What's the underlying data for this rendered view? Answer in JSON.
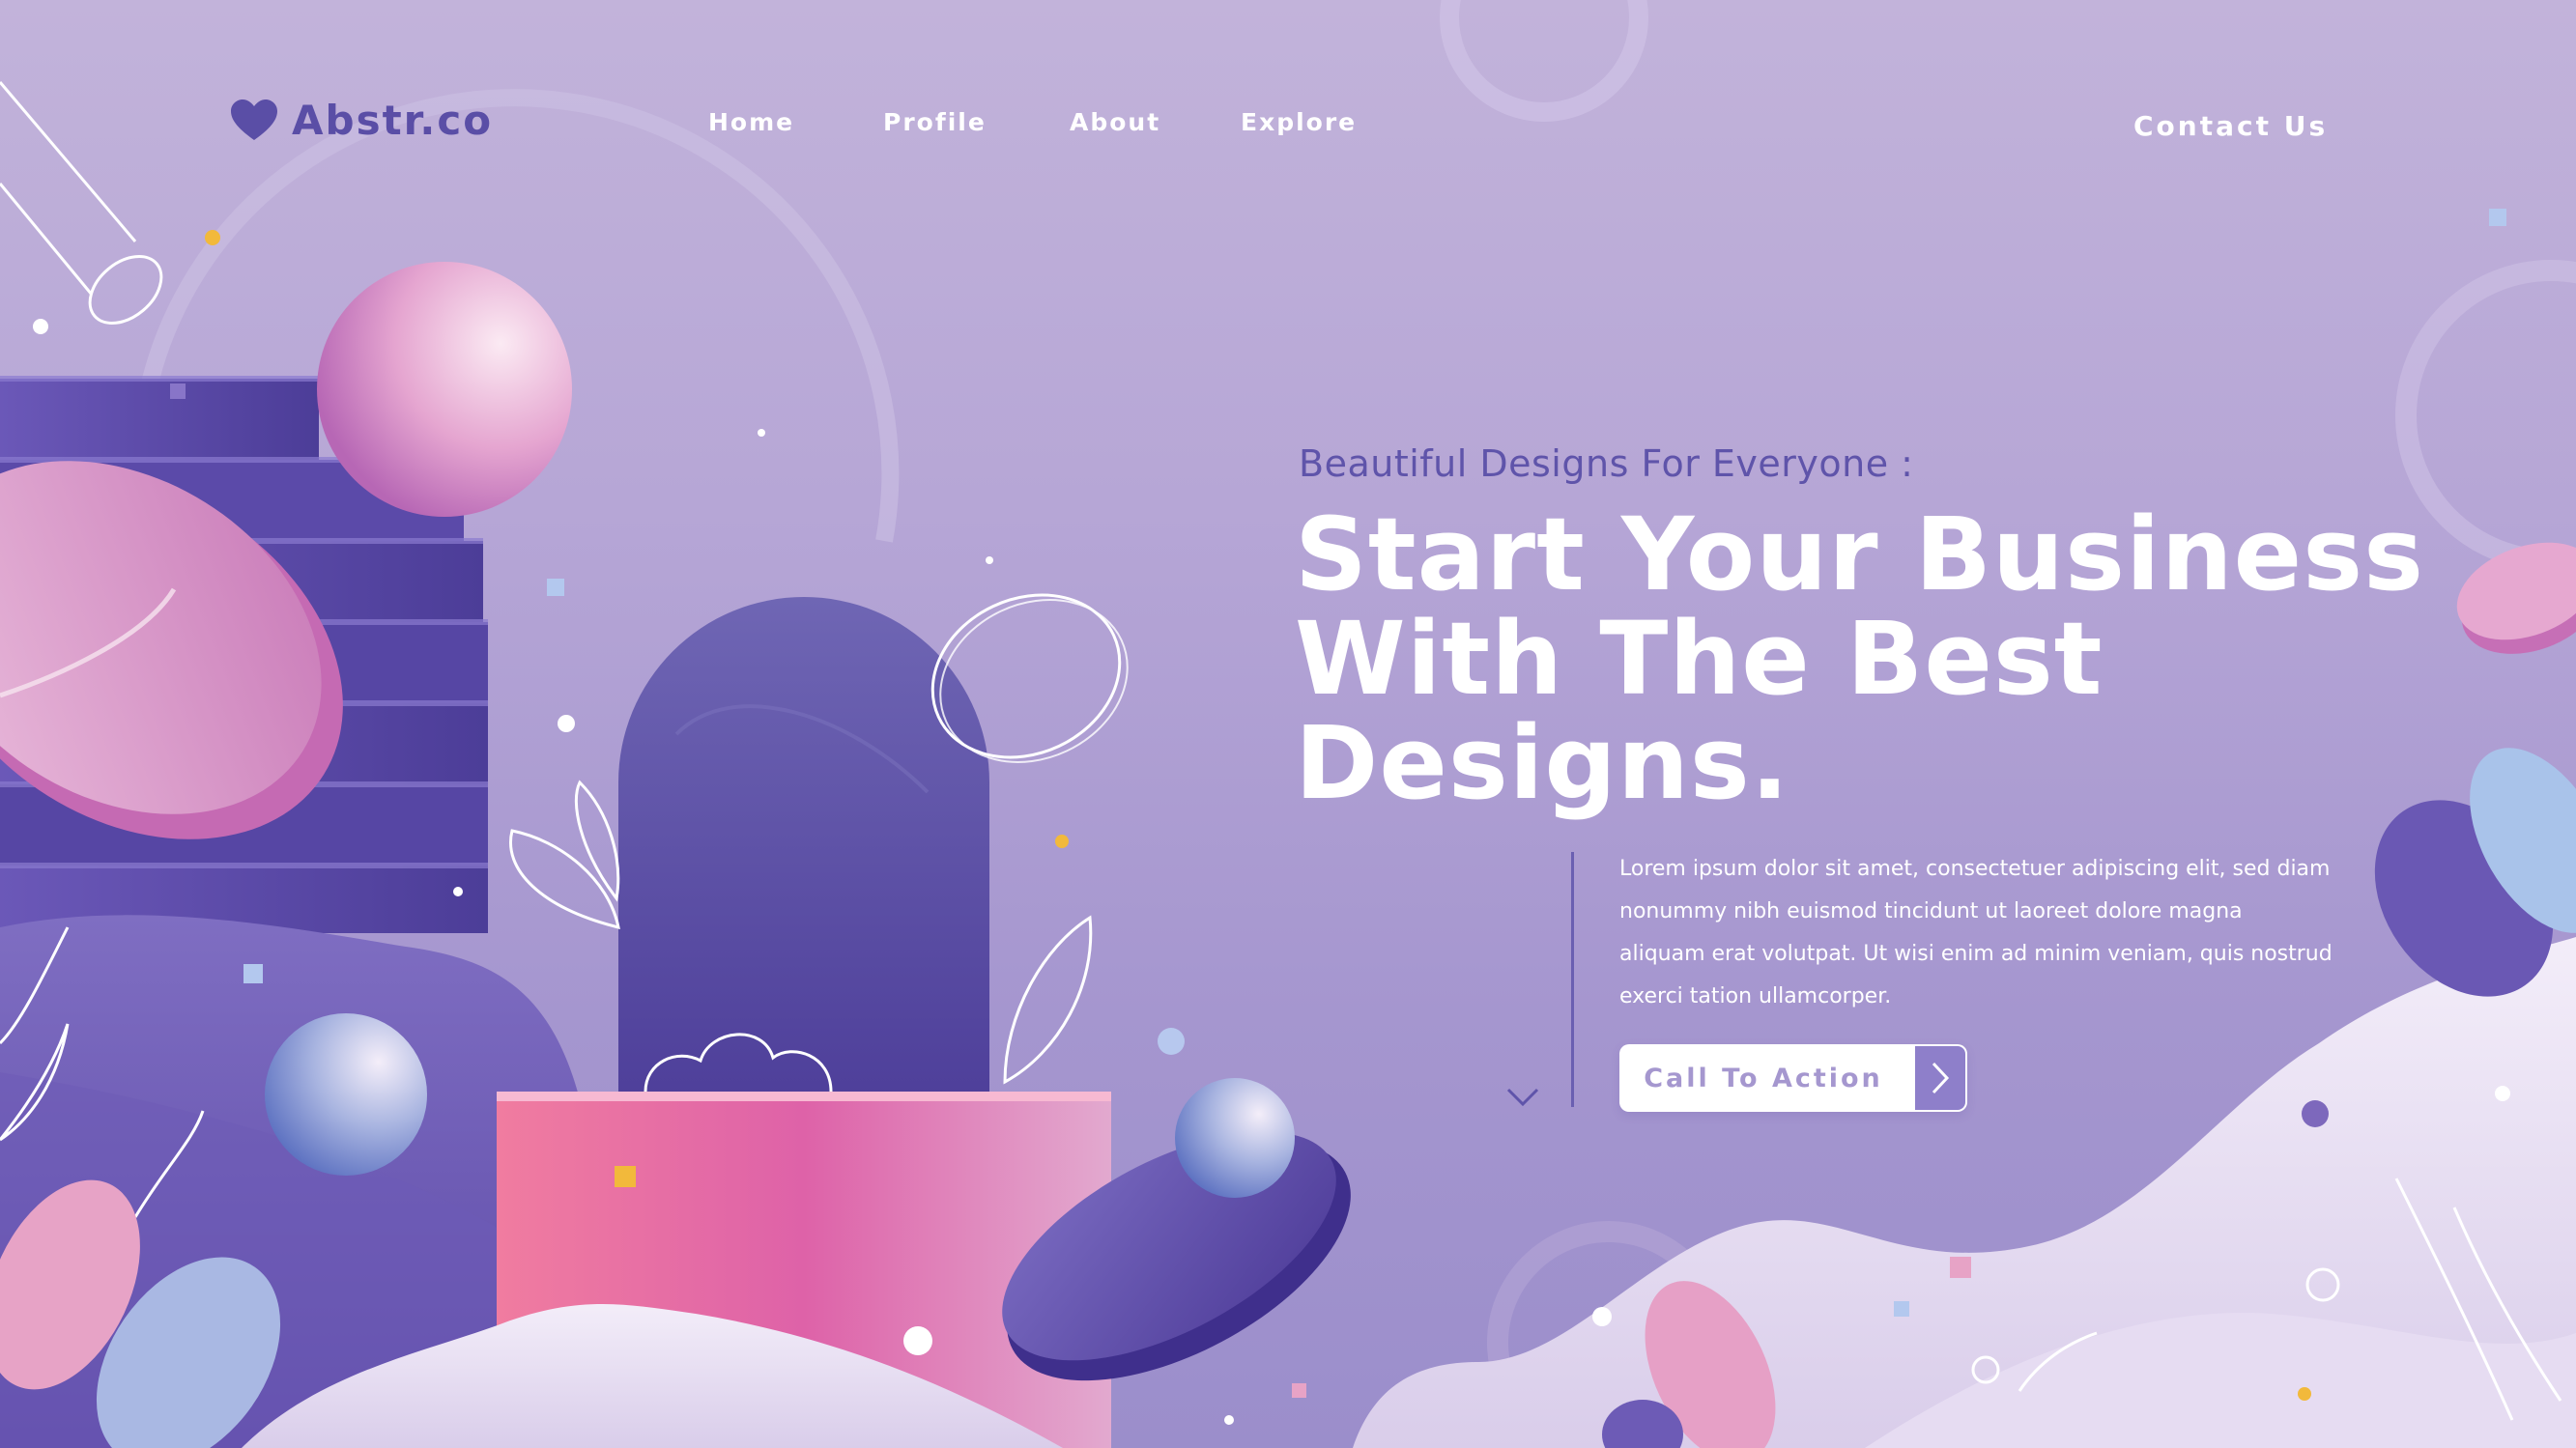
{
  "brand": {
    "name": "Abstr.co",
    "logo_icon": "heart-icon"
  },
  "nav": {
    "items": [
      {
        "label": "Home"
      },
      {
        "label": "Profile"
      },
      {
        "label": "About"
      },
      {
        "label": "Explore"
      }
    ],
    "contact_label": "Contact Us"
  },
  "hero": {
    "subtitle": "Beautiful Designs For Everyone :",
    "headline_lines": [
      "Start Your Business",
      "With The Best",
      "Designs."
    ],
    "paragraph": "Lorem ipsum dolor sit amet, consectetuer adipiscing elit, sed diam nonummy nibh euismod tincidunt ut laoreet dolore magna aliquam erat volutpat. Ut wisi enim ad minim veniam, quis nostrud exerci tation ullamcorper.",
    "cta_label": "Call To Action",
    "cta_icon": "chevron-right-icon",
    "scroll_icon": "chevron-down-icon"
  },
  "colors": {
    "background": "#b6a6d6",
    "accent_dark": "#5a4ea6",
    "text_light": "#ffffff",
    "pink": "#e27fb0",
    "purple": "#6a5cb0"
  }
}
